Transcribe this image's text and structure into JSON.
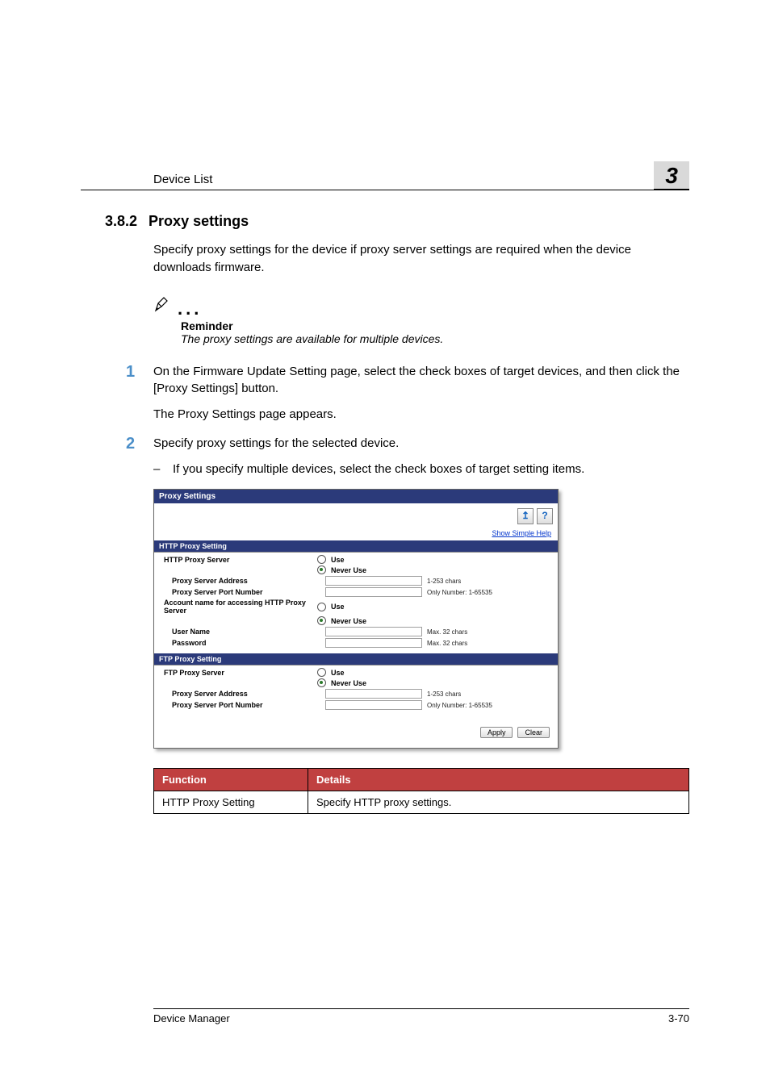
{
  "header": {
    "running_title": "Device List",
    "chapter_number": "3"
  },
  "section": {
    "number": "3.8.2",
    "title": "Proxy settings",
    "intro": "Specify proxy settings for the device if proxy server settings are required when the device downloads firmware."
  },
  "reminder": {
    "label": "Reminder",
    "text": "The proxy settings are available for multiple devices."
  },
  "steps": [
    {
      "num": "1",
      "text": "On the Firmware Update Setting page, select the check boxes of target devices, and then click the [Proxy Settings] button.",
      "after": "The Proxy Settings page appears."
    },
    {
      "num": "2",
      "text": "Specify proxy settings for the selected device.",
      "sub": "If you specify multiple devices, select the check boxes of target setting items."
    }
  ],
  "shot": {
    "title": "Proxy Settings",
    "simple_help": "Show Simple Help",
    "sections": {
      "http": {
        "bar": "HTTP Proxy Setting",
        "proxy_server": "HTTP Proxy Server",
        "use": "Use",
        "never_use": "Never Use",
        "addr_label": "Proxy Server Address",
        "addr_hint": "1-253 chars",
        "port_label": "Proxy Server Port Number",
        "port_hint": "Only Number: 1-65535",
        "acct_label": "Account name for accessing HTTP Proxy Server",
        "user_label": "User Name",
        "user_hint": "Max. 32 chars",
        "pass_label": "Password",
        "pass_hint": "Max. 32 chars"
      },
      "ftp": {
        "bar": "FTP Proxy Setting",
        "proxy_server": "FTP Proxy Server",
        "use": "Use",
        "never_use": "Never Use",
        "addr_label": "Proxy Server Address",
        "addr_hint": "1-253 chars",
        "port_label": "Proxy Server Port Number",
        "port_hint": "Only Number: 1-65535"
      }
    },
    "buttons": {
      "apply": "Apply",
      "clear": "Clear"
    }
  },
  "table": {
    "headers": {
      "function": "Function",
      "details": "Details"
    },
    "rows": [
      {
        "function": "HTTP Proxy Setting",
        "details": "Specify HTTP proxy settings."
      }
    ]
  },
  "footer": {
    "left": "Device Manager",
    "right": "3-70"
  }
}
